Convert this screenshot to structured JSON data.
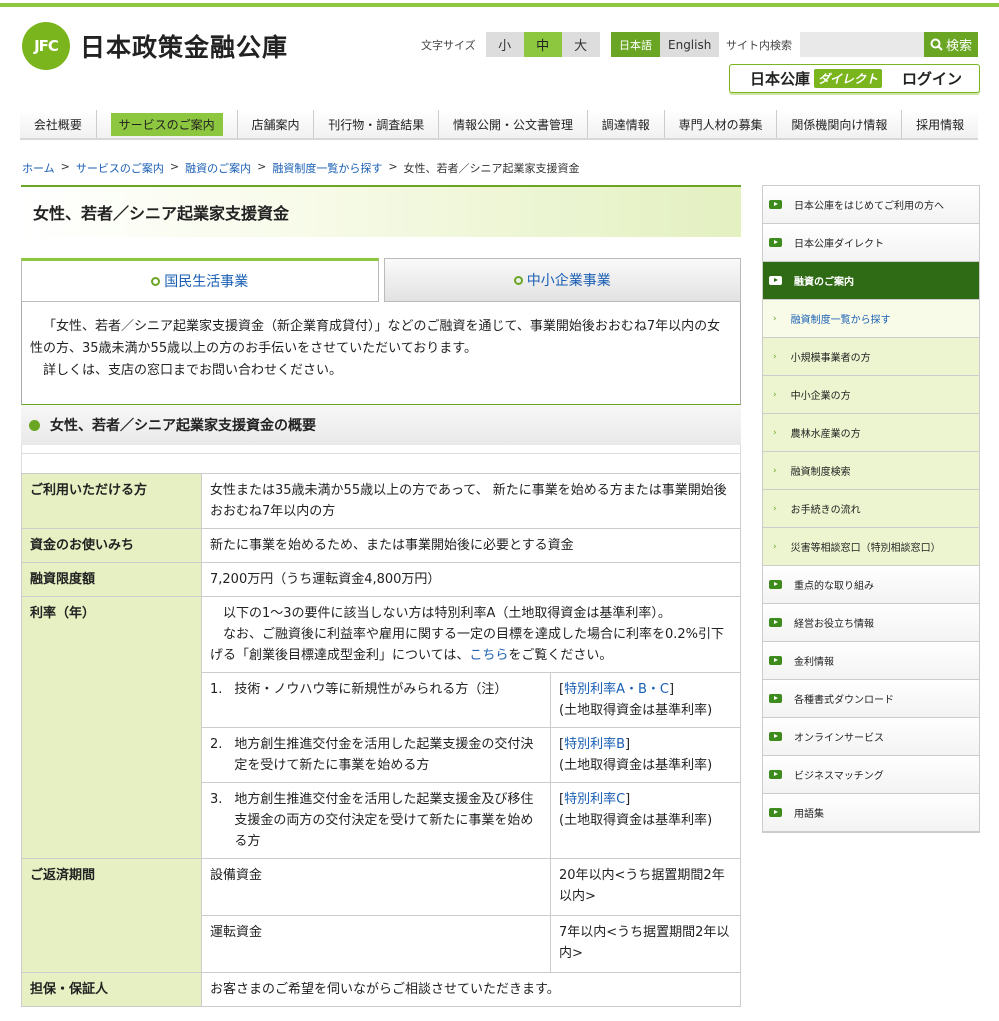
{
  "header": {
    "logo_badge": "JFC",
    "logo_text": "日本政策金融公庫",
    "fontsize_label": "文字サイズ",
    "fontsize_options": [
      "小",
      "中",
      "大"
    ],
    "lang_options": [
      "日本語",
      "English"
    ],
    "search_label": "サイト内検索",
    "search_placeholder": "",
    "search_button": "検索",
    "direct_prefix": "日本公庫",
    "direct_tag": "ダイレクト",
    "direct_login": "ログイン"
  },
  "gnav": [
    "会社概要",
    "サービスのご案内",
    "店舗案内",
    "刊行物・調査結果",
    "情報公開・公文書管理",
    "調達情報",
    "専門人材の募集",
    "関係機関向け情報",
    "採用情報"
  ],
  "breadcrumb": {
    "links": [
      "ホーム",
      "サービスのご案内",
      "融資のご案内",
      "融資制度一覧から探す"
    ],
    "current": "女性、若者／シニア起業家支援資金"
  },
  "main": {
    "title": "女性、若者／シニア起業家支援資金",
    "tabs": [
      "国民生活事業",
      "中小企業事業"
    ],
    "intro_1": "「女性、若者／シニア起業家支援資金（新企業育成貸付）」などのご融資を通じて、事業開始後おおむね7年以内の女性の方、35歳未満か55歳以上の方のお手伝いをさせていただいております。",
    "intro_2": "詳しくは、支店の窓口までお問い合わせください。",
    "section_title": "女性、若者／シニア起業家支援資金の概要",
    "rows": {
      "eligible_h": "ご利用いただける方",
      "eligible_v": "女性または35歳未満か55歳以上の方であって、 新たに事業を始める方または事業開始後おおむね7年以内の方",
      "use_h": "資金のお使いみち",
      "use_v": "新たに事業を始めるため、または事業開始後に必要とする資金",
      "limit_h": "融資限度額",
      "limit_v": "7,200万円（うち運転資金4,800万円）",
      "rate_h": "利率（年）",
      "rate_p1": "以下の1～3の要件に該当しない方は特別利率A（土地取得資金は基準利率）。",
      "rate_p2a": "なお、ご融資後に利益率や雇用に関する一定の目標を達成した場合に利率を0.2%引下げる「創業後目標達成型金利」については、",
      "rate_p2_link": "こちら",
      "rate_p2b": "をご覧ください。",
      "rate_items": [
        {
          "n": "1.",
          "text": "技術・ノウハウ等に新規性がみられる方（注）",
          "rate_link": "特別利率A・B・C",
          "note": "(土地取得資金は基準利率)"
        },
        {
          "n": "2.",
          "text": "地方創生推進交付金を活用した起業支援金の交付決定を受けて新たに事業を始める方",
          "rate_link": "特別利率B",
          "note": "(土地取得資金は基準利率)"
        },
        {
          "n": "3.",
          "text": "地方創生推進交付金を活用した起業支援金及び移住支援金の両方の交付決定を受けて新たに事業を始める方",
          "rate_link": "特別利率C",
          "note": "(土地取得資金は基準利率)"
        }
      ],
      "repay_h": "ご返済期間",
      "repay_items": [
        {
          "k": "設備資金",
          "v": "20年以内<うち据置期間2年以内>"
        },
        {
          "k": "運転資金",
          "v": "7年以内<うち据置期間2年以内>"
        }
      ],
      "collateral_h": "担保・保証人",
      "collateral_v": "お客さまのご希望を伺いながらご相談させていただきます。"
    }
  },
  "side": {
    "items": [
      {
        "label": "日本公庫をはじめてご利用の方へ",
        "type": "top"
      },
      {
        "label": "日本公庫ダイレクト",
        "type": "top"
      },
      {
        "label": "融資のご案内",
        "type": "active"
      },
      {
        "label": "融資制度一覧から探す",
        "type": "current"
      },
      {
        "label": "小規模事業者の方",
        "type": "sub"
      },
      {
        "label": "中小企業の方",
        "type": "sub"
      },
      {
        "label": "農林水産業の方",
        "type": "sub"
      },
      {
        "label": "融資制度検索",
        "type": "sub"
      },
      {
        "label": "お手続きの流れ",
        "type": "sub"
      },
      {
        "label": "災害等相談窓口（特別相談窓口）",
        "type": "sub"
      },
      {
        "label": "重点的な取り組み",
        "type": "top"
      },
      {
        "label": "経営お役立ち情報",
        "type": "top"
      },
      {
        "label": "金利情報",
        "type": "top"
      },
      {
        "label": "各種書式ダウンロード",
        "type": "top"
      },
      {
        "label": "オンラインサービス",
        "type": "top"
      },
      {
        "label": "ビジネスマッチング",
        "type": "top"
      },
      {
        "label": "用語集",
        "type": "top"
      }
    ]
  },
  "colors": {
    "brand_green": "#8dc63f",
    "dark_green": "#2f6b15",
    "link_blue": "#1a5fb4",
    "header_bg": "#e6f0c2"
  }
}
